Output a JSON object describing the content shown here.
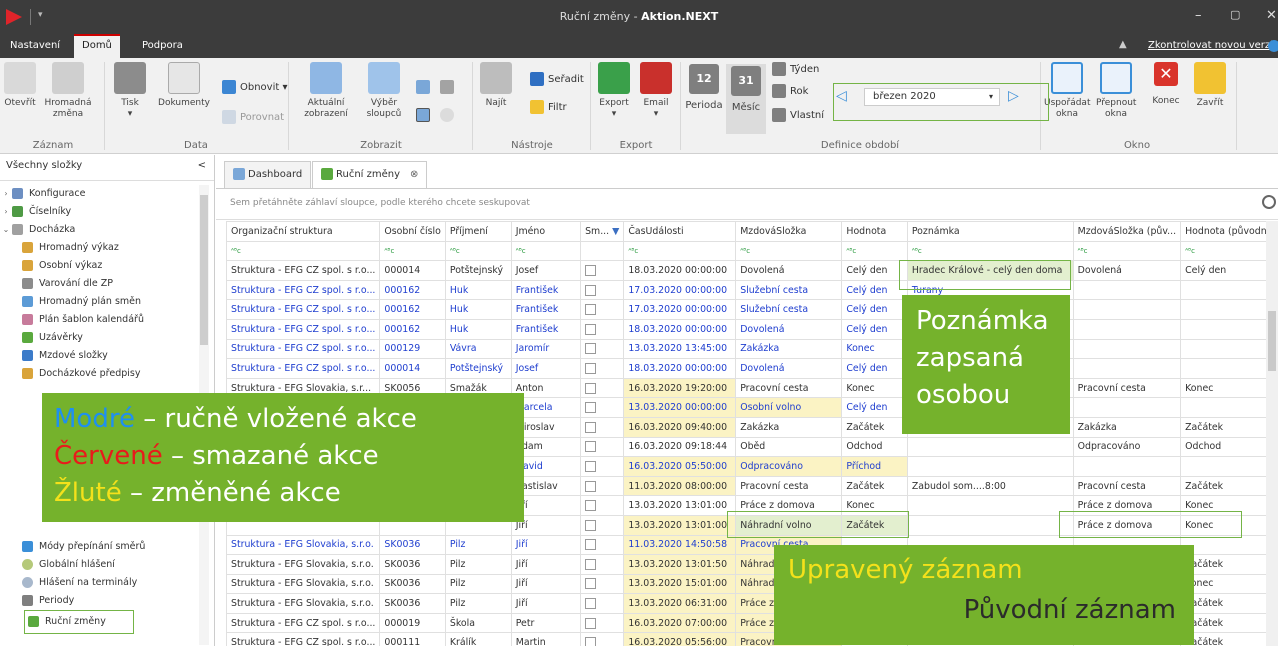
{
  "window": {
    "title_part1": "Ruční změny - ",
    "title_part2": "Aktion.NEXT",
    "minimize": "–",
    "maximize": "▢",
    "close": "✕"
  },
  "tabs": {
    "items": [
      "Nastavení",
      "Domů",
      "Podpora"
    ],
    "collapse_glyph": "▲",
    "update_link": "Zkontrolovat novou verzi"
  },
  "ribbon": {
    "groups": {
      "zaznam": "Záznam",
      "data": "Data",
      "zobrazit": "Zobrazit",
      "nastroje": "Nástroje",
      "export": "Export",
      "definice": "Definice období",
      "okno": "Okno"
    },
    "buttons": {
      "otevrit": "Otevřít",
      "hromadna": "Hromadná změna",
      "tisk": "Tisk",
      "dokumenty": "Dokumenty",
      "obnovit": "Obnovit",
      "porovnat": "Porovnat",
      "aktualni": "Aktuální zobrazení",
      "vyber": "Výběr sloupců",
      "najit": "Najít",
      "seradit": "Seřadit",
      "filtr": "Filtr",
      "export": "Export",
      "email": "Email",
      "perioda": "Perioda",
      "mesic": "Měsíc",
      "tyden": "Týden",
      "rok": "Rok",
      "vlastni": "Vlastní",
      "usporadat": "Uspořádat okna",
      "prepnout": "Přepnout okna",
      "konec": "Konec",
      "zavrit": "Zavřít"
    },
    "period_value": "březen 2020",
    "cal_icon_12": "12",
    "cal_icon_31": "31"
  },
  "sidebar": {
    "header": "Všechny složky",
    "collapse_glyph": "<",
    "items": [
      "Konfigurace",
      "Číselníky",
      "Docházka",
      "Hromadný výkaz",
      "Osobní výkaz",
      "Varování dle ZP",
      "Hromadný plán směn",
      "Plán šablon kalendářů",
      "Uzávěrky",
      "Mzdové složky",
      "Docházkové předpisy",
      "Módy přepínání směrů",
      "Globální hlášení",
      "Hlášení na terminály",
      "Periody",
      "Ruční změny"
    ]
  },
  "doc_tabs": [
    "Dashboard",
    "Ruční změny"
  ],
  "grid": {
    "group_hint": "Sem přetáhněte záhlaví sloupce, podle kterého chcete seskupovat",
    "columns": [
      "Organizační struktura",
      "Osobní číslo",
      "Příjmení",
      "Jméno",
      "Sm...",
      "ČasUdálosti",
      "MzdováSložka",
      "Hodnota",
      "Poznámka",
      "MzdováSložka (pův...",
      "Hodnota (původní)"
    ],
    "filter_glyph": "ᴬᴮc",
    "rows": [
      [
        "Struktura - EFG CZ spol. s r.o...",
        "000014",
        "Potštejnský",
        "Josef",
        "",
        "18.03.2020 00:00:00",
        "Dovolená",
        "Celý den",
        "Hradec Králové - celý den doma",
        "Dovolená",
        "Celý den"
      ],
      [
        "Struktura - EFG CZ spol. s r.o...",
        "000162",
        "Huk",
        "František",
        "",
        "17.03.2020 00:00:00",
        "Služební cesta",
        "Celý den",
        "Turany",
        "",
        ""
      ],
      [
        "Struktura - EFG CZ spol. s r.o...",
        "000162",
        "Huk",
        "František",
        "",
        "17.03.2020 00:00:00",
        "Služební cesta",
        "Celý den",
        "",
        "",
        ""
      ],
      [
        "Struktura - EFG CZ spol. s r.o...",
        "000162",
        "Huk",
        "František",
        "",
        "18.03.2020 00:00:00",
        "Dovolená",
        "Celý den",
        "",
        "",
        ""
      ],
      [
        "Struktura - EFG CZ spol. s r.o...",
        "000129",
        "Vávra",
        "Jaromír",
        "",
        "13.03.2020 13:45:00",
        "Zakázka",
        "Konec",
        "",
        "",
        ""
      ],
      [
        "Struktura - EFG CZ spol. s r.o...",
        "000014",
        "Potštejnský",
        "Josef",
        "",
        "18.03.2020 00:00:00",
        "Dovolená",
        "Celý den",
        "",
        "",
        ""
      ],
      [
        "Struktura - EFG Slovakia, s.r...",
        "SK0056",
        "Smažák",
        "Anton",
        "",
        "16.03.2020 19:20:00",
        "Pracovní cesta",
        "Konec",
        "",
        "Pracovní cesta",
        "Konec"
      ],
      [
        "",
        "",
        "",
        "Marcela",
        "",
        "13.03.2020 00:00:00",
        "Osobní volno",
        "Celý den",
        "",
        "",
        ""
      ],
      [
        "",
        "",
        "",
        "Miroslav",
        "",
        "16.03.2020 09:40:00",
        "Zakázka",
        "Začátek",
        "",
        "Zakázka",
        "Začátek"
      ],
      [
        "",
        "",
        "",
        "Adam",
        "",
        "16.03.2020 09:18:44",
        "Oběd",
        "Odchod",
        "",
        "Odpracováno",
        "Odchod"
      ],
      [
        "",
        "",
        "",
        "David",
        "",
        "16.03.2020 05:50:00",
        "Odpracováno",
        "Příchod",
        "",
        "",
        ""
      ],
      [
        "",
        "",
        "",
        "Rastislav",
        "",
        "11.03.2020 08:00:00",
        "Pracovní cesta",
        "Začátek",
        "Zabudol som....8:00",
        "Pracovní cesta",
        "Začátek"
      ],
      [
        "",
        "",
        "",
        "Jiří",
        "",
        "13.03.2020 13:01:00",
        "Práce z domova",
        "Konec",
        "",
        "Práce z domova",
        "Konec"
      ],
      [
        "",
        "",
        "",
        "Jiří",
        "",
        "13.03.2020 13:01:00",
        "Náhradní volno",
        "Začátek",
        "",
        "Práce z domova",
        "Konec"
      ],
      [
        "Struktura - EFG Slovakia, s.r.o.",
        "SK0036",
        "Pilz",
        "Jiří",
        "",
        "11.03.2020 14:50:58",
        "Pracovní cesta",
        "",
        "",
        "",
        ""
      ],
      [
        "Struktura - EFG Slovakia, s.r.o.",
        "SK0036",
        "Pilz",
        "Jiří",
        "",
        "13.03.2020 13:01:50",
        "Náhradní volno",
        "",
        "",
        "",
        "Začátek"
      ],
      [
        "Struktura - EFG Slovakia, s.r.o.",
        "SK0036",
        "Pilz",
        "Jiří",
        "",
        "13.03.2020 15:01:00",
        "Náhradní volno",
        "",
        "",
        "",
        "Konec"
      ],
      [
        "Struktura - EFG Slovakia, s.r.o.",
        "SK0036",
        "Pilz",
        "Jiří",
        "",
        "13.03.2020 06:31:00",
        "Práce z domova",
        "",
        "",
        "",
        "Začátek"
      ],
      [
        "Struktura - EFG CZ spol. s r.o...",
        "000019",
        "Škola",
        "Petr",
        "",
        "16.03.2020 07:00:00",
        "Práce z domova",
        "",
        "",
        "",
        "Začátek"
      ],
      [
        "Struktura - EFG CZ spol. s r.o...",
        "000111",
        "Králík",
        "Martin",
        "",
        "16.03.2020 05:56:00",
        "Pracovní cesta",
        "Začátek",
        "",
        "Pracovní cesta",
        "Začátek"
      ]
    ]
  },
  "callouts": {
    "legend": {
      "blue_word": "Modré",
      "blue_rest": " – ručně vložené akce",
      "red_word": "Červené",
      "red_rest": " – smazané akce",
      "yellow_word": "Žluté",
      "yellow_rest": " – změněné akce"
    },
    "note": "Poznámka zapsaná osobou",
    "edited": "Upravený záznam",
    "original": "Původní záznam"
  },
  "colors": {
    "accent_green": "#75b22c",
    "manual_blue": "#1f3ecf",
    "deleted_red": "#e81b1b",
    "changed_yellow": "#f4e11b",
    "changed_row_bg": "#fbf3c4"
  }
}
